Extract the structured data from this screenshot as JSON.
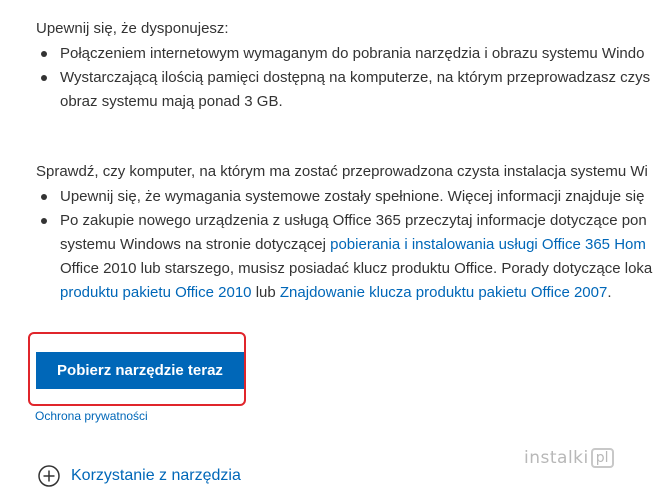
{
  "section1": {
    "intro": "Upewnij się, że dysponujesz:",
    "bullet1": "Połączeniem internetowym wymaganym do pobrania narzędzia i obrazu systemu Windo",
    "bullet2_line1": "Wystarczającą ilością pamięci dostępną na komputerze, na którym przeprowadzasz czys",
    "bullet2_line2": "obraz systemu mają ponad 3 GB."
  },
  "section2": {
    "intro": "Sprawdź, czy komputer, na którym ma zostać przeprowadzona czysta instalacja systemu Wi",
    "bullet1": "Upewnij się, że wymagania systemowe zostały spełnione. Więcej informacji znajduje się",
    "bullet2_line1": "Po zakupie nowego urządzenia z usługą Office 365 przeczytaj informacje dotyczące pon",
    "bullet2_line2_pre": "systemu Windows na stronie dotyczącej ",
    "bullet2_line2_link": "pobierania i instalowania usługi Office 365 Hom",
    "bullet2_line3": "Office 2010 lub starszego, musisz posiadać klucz produktu Office. Porady dotyczące loka",
    "bullet2_line4_link1": "produktu pakietu Office 2010",
    "bullet2_line4_mid": " lub ",
    "bullet2_line4_link2": "Znajdowanie klucza produktu pakietu Office 2007",
    "bullet2_line4_end": "."
  },
  "download": {
    "button_label": "Pobierz narzędzie teraz",
    "privacy_link": "Ochrona prywatności"
  },
  "expander": {
    "icon": "plus-circle-icon",
    "label": "Korzystanie z narzędzia"
  },
  "watermark": {
    "text": "instalki",
    "badge": "pl"
  },
  "colors": {
    "link": "#0067b8",
    "button_bg": "#0067b8",
    "highlight": "#e0252b"
  }
}
